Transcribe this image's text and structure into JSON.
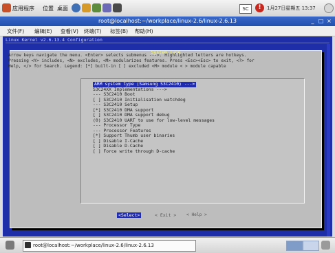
{
  "top_panel": {
    "menus": [
      "应用程序",
      "位置",
      "桌面"
    ],
    "indicator": "SC",
    "clock": "1月27日星期五 13:37",
    "launchers": [
      {
        "icon": "globe-icon",
        "color": "#3f6fb5"
      },
      {
        "icon": "mail-icon",
        "color": "#d59a2a"
      },
      {
        "icon": "chat-icon",
        "color": "#5d8d3c"
      },
      {
        "icon": "edit-icon",
        "color": "#6b6bb8"
      },
      {
        "icon": "network-icon",
        "color": "#4a4a4a"
      }
    ]
  },
  "window": {
    "title": "root@localhost:~/workplace/linux-2.6/linux-2.6.13",
    "menu": [
      "文件(F)",
      "编辑(E)",
      "查看(V)",
      "终端(T)",
      "标签(B)",
      "帮助(H)"
    ]
  },
  "terminal": {
    "header": "Linux Kernel v2.6.13.4 Configuration",
    "dialog_title": "System Type",
    "help_lines": [
      "Arrow keys navigate the menu.  <Enter> selects submenus --->.  Highlighted letters are hotkeys.",
      "Pressing <Y> includes, <N> excludes, <M> modularizes features.  Press <Esc><Esc> to exit, <?> for",
      "Help, </> for Search.  Legend: [*] built-in  [ ] excluded  <M> module  < > module capable"
    ],
    "options": [
      {
        "text": "ARM system type (Samsung S3C2410)  --->",
        "selected": true
      },
      {
        "text": "   S3C24XX Implementations  --->",
        "selected": false
      },
      {
        "text": "--- S3C2410 Boot",
        "selected": false
      },
      {
        "text": "[ ]   S3C2410 Initialisation watchdog",
        "selected": false
      },
      {
        "text": "--- S3C2410 Setup",
        "selected": false
      },
      {
        "text": "[*] S3C2410 DMA support",
        "selected": false
      },
      {
        "text": "[ ]   S3C2410 DMA support debug",
        "selected": false
      },
      {
        "text": "(0) S3C2410 UART to use for low-level messages",
        "selected": false
      },
      {
        "text": "--- Processor Type",
        "selected": false
      },
      {
        "text": "--- Processor Features",
        "selected": false
      },
      {
        "text": "[*] Support Thumb user binaries",
        "selected": false
      },
      {
        "text": "[ ] Disable I-Cache",
        "selected": false
      },
      {
        "text": "[ ] Disable D-Cache",
        "selected": false
      },
      {
        "text": "[ ]   Force write through D-cache",
        "selected": false
      }
    ],
    "buttons": {
      "select": "<Select>",
      "exit": "< Exit >",
      "help": "< Help >"
    }
  },
  "taskbar": {
    "task_label": "root@localhost:~/workplace/linux-2.6/linux-2.6.13"
  }
}
